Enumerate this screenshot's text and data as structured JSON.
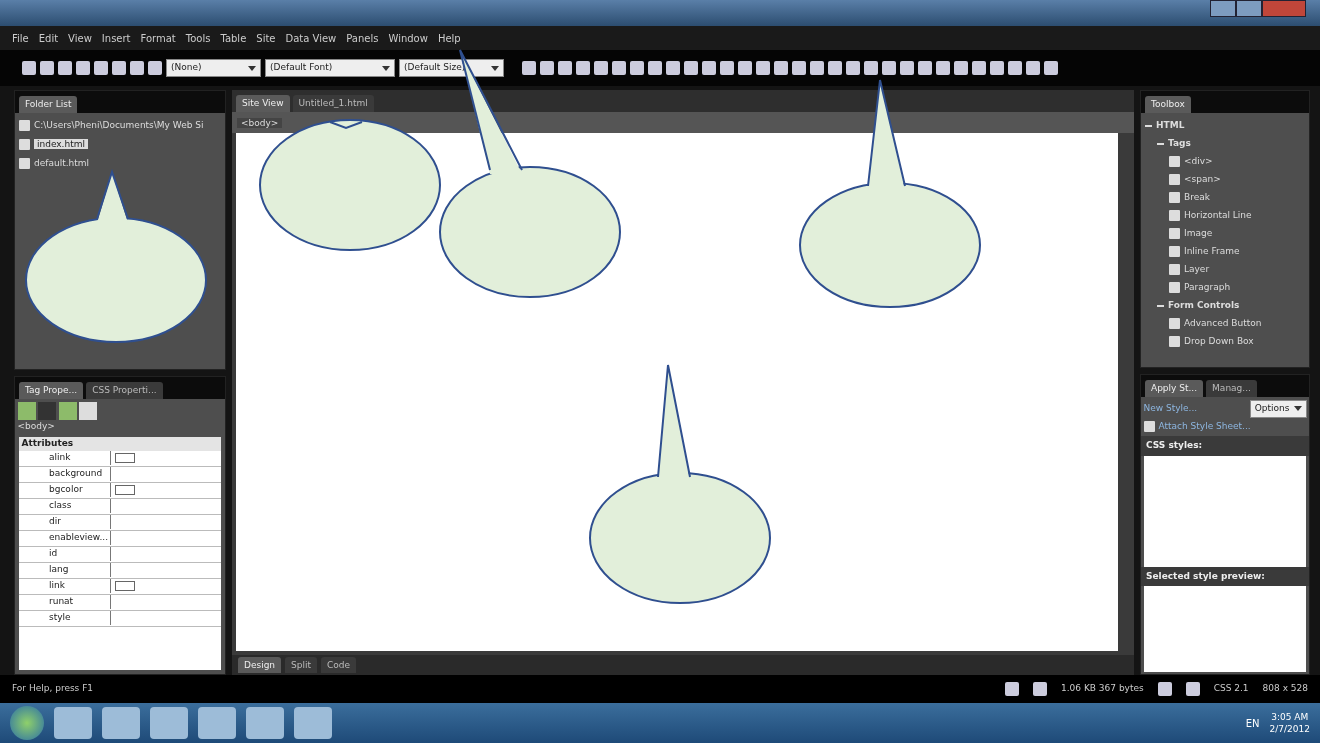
{
  "menu": [
    "File",
    "Edit",
    "View",
    "Insert",
    "Format",
    "Tools",
    "Table",
    "Site",
    "Data View",
    "Panels",
    "Window",
    "Help"
  ],
  "toolbar": {
    "style": "(None)",
    "font": "(Default Font)",
    "size": "(Default Size)"
  },
  "folder_list": {
    "title": "Folder List",
    "root": {
      "label": "C:\\Users\\Pheni\\Documents\\My Web Si",
      "children": [
        {
          "label": "index.html",
          "selected": true
        },
        {
          "label": "default.html",
          "selected": false
        }
      ]
    }
  },
  "tag_panel": {
    "tabs": [
      {
        "label": "Tag Prope...",
        "selected": true
      },
      {
        "label": "CSS Properti...",
        "selected": false
      }
    ],
    "tag": "<body>",
    "header": "Attributes",
    "rows": [
      {
        "name": "alink",
        "swatch": true
      },
      {
        "name": "background",
        "swatch": false
      },
      {
        "name": "bgcolor",
        "swatch": true
      },
      {
        "name": "class",
        "swatch": false
      },
      {
        "name": "dir",
        "swatch": false
      },
      {
        "name": "enableview...",
        "swatch": false
      },
      {
        "name": "id",
        "swatch": false
      },
      {
        "name": "lang",
        "swatch": false
      },
      {
        "name": "link",
        "swatch": true
      },
      {
        "name": "runat",
        "swatch": false
      },
      {
        "name": "style",
        "swatch": false
      }
    ]
  },
  "editor": {
    "tabs": [
      {
        "label": "Site View",
        "selected": true
      },
      {
        "label": "Untitled_1.html",
        "selected": false
      }
    ],
    "breadcrumb": "<body>",
    "views": [
      {
        "label": "Design",
        "selected": true
      },
      {
        "label": "Split",
        "selected": false
      },
      {
        "label": "Code",
        "selected": false
      }
    ]
  },
  "toolbox": {
    "title": "Toolbox",
    "tree": [
      {
        "label": "HTML",
        "children": [
          {
            "label": "Tags",
            "children": [
              {
                "label": "<div>"
              },
              {
                "label": "<span>"
              },
              {
                "label": "Break"
              },
              {
                "label": "Horizontal Line"
              },
              {
                "label": "Image"
              },
              {
                "label": "Inline Frame"
              },
              {
                "label": "Layer"
              },
              {
                "label": "Paragraph"
              }
            ]
          },
          {
            "label": "Form Controls",
            "children": [
              {
                "label": "Advanced Button"
              },
              {
                "label": "Drop Down Box"
              }
            ]
          }
        ]
      }
    ]
  },
  "styles_panel": {
    "tabs": [
      {
        "label": "Apply St...",
        "selected": true
      },
      {
        "label": "Manag...",
        "selected": false
      }
    ],
    "new_style": "New Style...",
    "options": "Options",
    "attach": "Attach Style Sheet...",
    "css_header": "CSS styles:",
    "preview_header": "Selected style preview:"
  },
  "status_bar": {
    "help": "For Help, press F1",
    "size": "1.06 KB  367 bytes",
    "css": "CSS 2.1",
    "dimensions": "808 x 528"
  },
  "taskbar": {
    "language": "EN",
    "time": "3:05 AM",
    "date": "2/7/2012"
  }
}
